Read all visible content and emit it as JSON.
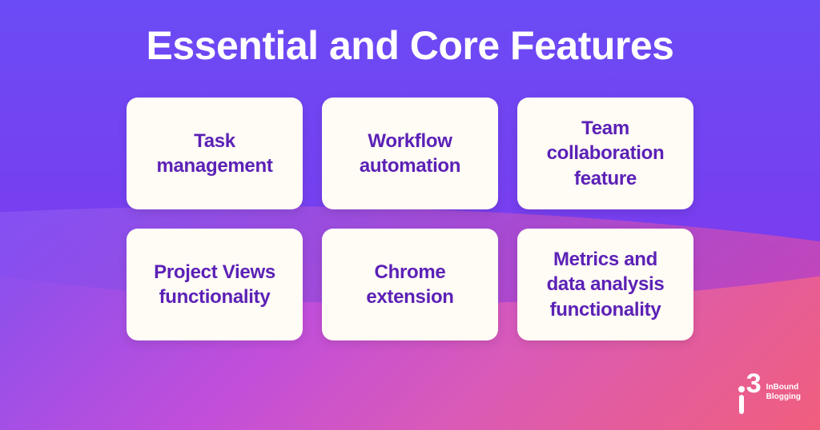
{
  "title": "Essential and Core Features",
  "features": {
    "card0": "Task management",
    "card1": "Workflow automation",
    "card2": "Team collaboration feature",
    "card3": "Project Views functionality",
    "card4": "Chrome extension",
    "card5": "Metrics and data analysis functionality"
  },
  "logo": {
    "line1": "InBound",
    "line2": "Blogging"
  }
}
